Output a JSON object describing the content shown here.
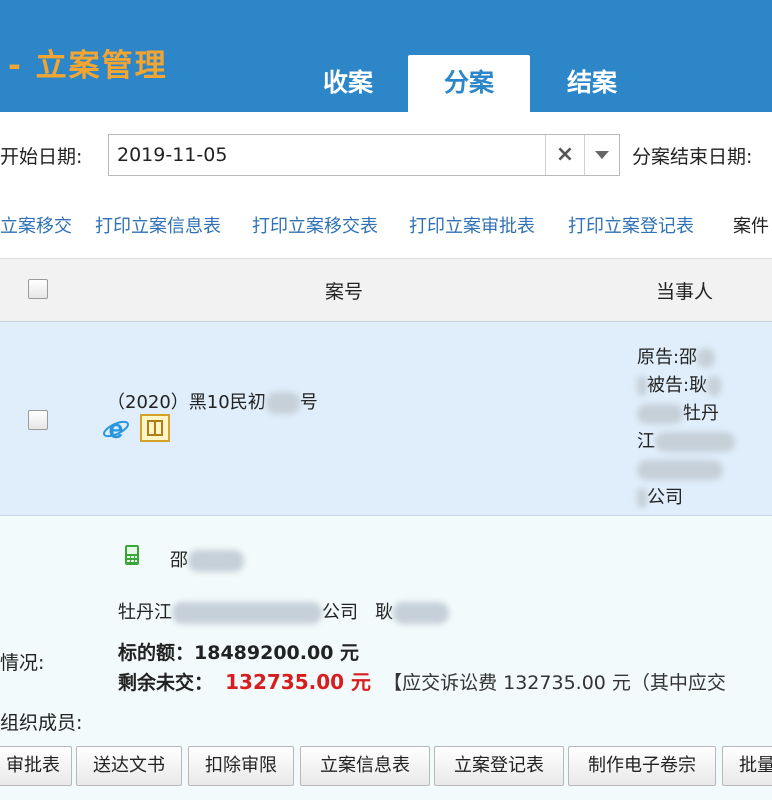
{
  "header": {
    "title": "- 立案管理",
    "tabs": [
      {
        "label": "收案",
        "active": false
      },
      {
        "label": "分案",
        "active": true
      },
      {
        "label": "结案",
        "active": false
      }
    ],
    "colors": {
      "header_bg": "#2d86c8",
      "title": "#f2a530"
    }
  },
  "filter": {
    "start_label": "开始日期:",
    "start_value": "2019-11-05",
    "end_label": "分案结束日期:"
  },
  "actions": [
    "立案移交",
    "打印立案信息表",
    "打印立案移交表",
    "打印立案审批表",
    "打印立案登记表",
    "案件"
  ],
  "table": {
    "headers": {
      "case_no": "案号",
      "party": "当事人"
    },
    "row": {
      "case_no": "（2020）黑10民初",
      "case_no_suffix": "号",
      "parties": [
        "原告:邵",
        "被告:耿",
        "牡丹",
        "江",
        "公司"
      ]
    }
  },
  "detail": {
    "contact": "邵",
    "company_tail": "公司",
    "second_party": "耿",
    "situation_label": "情况:",
    "subject_label": "标的额：",
    "subject_value": "18489200.00 元",
    "remaining_label": "剩余未交：",
    "remaining_value": "132735.00 元",
    "fee_note": "【应交诉讼费  132735.00 元（其中应交",
    "members_label": "组织成员:",
    "company_head": "牡丹江",
    "colors": {
      "amount": "#d71e1e"
    }
  },
  "buttons": [
    "审批表",
    "送达文书",
    "扣除审限",
    "立案信息表",
    "立案登记表",
    "制作电子卷宗",
    "批量"
  ]
}
